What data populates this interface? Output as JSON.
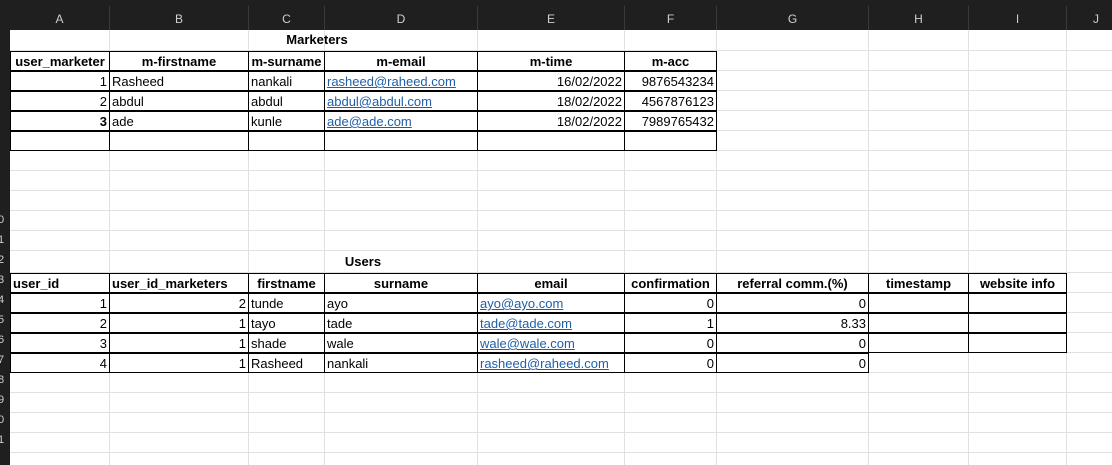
{
  "columns": [
    "A",
    "B",
    "C",
    "D",
    "E",
    "F",
    "G",
    "H",
    "I",
    "J"
  ],
  "rows": [
    "",
    "",
    "",
    "",
    "",
    "",
    "",
    "",
    "",
    "0",
    "1",
    "2",
    "3",
    "4",
    "5",
    "6",
    "7",
    "8",
    "9",
    "0",
    "1"
  ],
  "marketers": {
    "title": "Marketers",
    "headers": [
      "user_marketer",
      "m-firstname",
      "m-surname",
      "m-email",
      "m-time",
      "m-acc"
    ],
    "rows": [
      {
        "id": "1",
        "first": "Rasheed",
        "sur": "nankali",
        "email": "rasheed@raheed.com",
        "time": "16/02/2022",
        "acc": "9876543234"
      },
      {
        "id": "2",
        "first": "abdul",
        "sur": "abdul",
        "email": "abdul@abdul.com",
        "time": "18/02/2022",
        "acc": "4567876123"
      },
      {
        "id": "3",
        "first": "ade",
        "sur": "kunle",
        "email": "ade@ade.com",
        "time": "18/02/2022",
        "acc": "7989765432"
      }
    ]
  },
  "users": {
    "title": "Users",
    "headers": [
      "user_id",
      "user_id_marketers",
      "firstname",
      "surname",
      "email",
      "confirmation",
      "referral comm.(%)",
      "timestamp",
      "website info"
    ],
    "rows": [
      {
        "id": "1",
        "mk": "2",
        "first": "tunde",
        "sur": "ayo",
        "email": "ayo@ayo.com",
        "conf": "0",
        "ref": "0"
      },
      {
        "id": "2",
        "mk": "1",
        "first": "tayo",
        "sur": "tade",
        "email": "tade@tade.com",
        "conf": "1",
        "ref": "8.33"
      },
      {
        "id": "3",
        "mk": "1",
        "first": "shade",
        "sur": "wale",
        "email": "wale@wale.com",
        "conf": "0",
        "ref": "0"
      },
      {
        "id": "4",
        "mk": "1",
        "first": "Rasheed",
        "sur": "nankali",
        "email": "rasheed@raheed.com",
        "conf": "0",
        "ref": "0"
      }
    ]
  }
}
